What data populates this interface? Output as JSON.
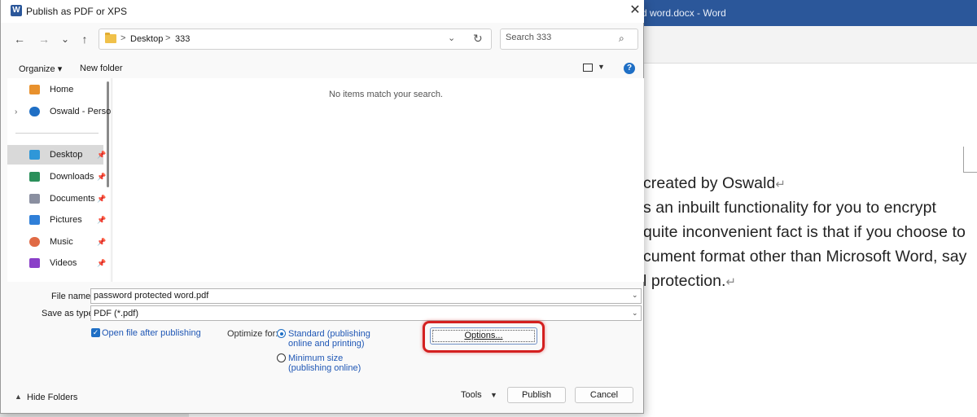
{
  "word": {
    "title": "d word.docx  -  Word",
    "doc_lines": [
      "created by Oswald",
      "s an inbuilt functionality for you to encrypt",
      "quite inconvenient fact is that if you choose to",
      "cument format other than Microsoft Word, say",
      "l protection."
    ],
    "return_mark": "↵"
  },
  "dialog": {
    "title": "Publish as PDF or XPS",
    "logo_letter": "W",
    "close_glyph": "✕",
    "nav": {
      "back": "←",
      "forward": "→",
      "dropdown": "⌄",
      "up": "↑"
    },
    "breadcrumb": [
      "Desktop",
      "333"
    ],
    "crumb_sep": ">",
    "search_placeholder": "Search 333",
    "toolbar": {
      "organize": "Organize ▾",
      "new_folder": "New folder",
      "help": "?"
    },
    "sidebar": {
      "items": [
        {
          "label": "Home",
          "icon": "home-icon",
          "color": "#e8912d"
        },
        {
          "label": "Oswald - Persor",
          "icon": "onedrive-icon",
          "color": "#1f6fc5"
        },
        {
          "label": "Desktop",
          "icon": "desktop-icon",
          "color": "#2f97d8",
          "selected": true
        },
        {
          "label": "Downloads",
          "icon": "downloads-icon",
          "color": "#2a8f5a"
        },
        {
          "label": "Documents",
          "icon": "documents-icon",
          "color": "#8a8fa0"
        },
        {
          "label": "Pictures",
          "icon": "pictures-icon",
          "color": "#2f7fd8"
        },
        {
          "label": "Music",
          "icon": "music-icon",
          "color": "#e06a45"
        },
        {
          "label": "Videos",
          "icon": "videos-icon",
          "color": "#8a3fc8"
        }
      ]
    },
    "empty_message": "No items match your search.",
    "form": {
      "file_name_label": "File name:",
      "file_name_value": "password protected word.pdf",
      "save_type_label": "Save as type:",
      "save_type_value": "PDF (*.pdf)",
      "open_after_label": "Open file after publishing",
      "open_after_checked": true,
      "optimize_label": "Optimize for:",
      "standard_line1": "Standard (publishing",
      "standard_line2": "online and printing)",
      "minimum_line1": "Minimum size",
      "minimum_line2": "(publishing online)",
      "selected_option": "standard",
      "options_button": "Options..."
    },
    "footer": {
      "hide_folders": "Hide Folders",
      "tools": "Tools",
      "publish": "Publish",
      "cancel": "Cancel"
    },
    "accent_color": "#1f6fc5",
    "highlight_color": "#d42020"
  }
}
